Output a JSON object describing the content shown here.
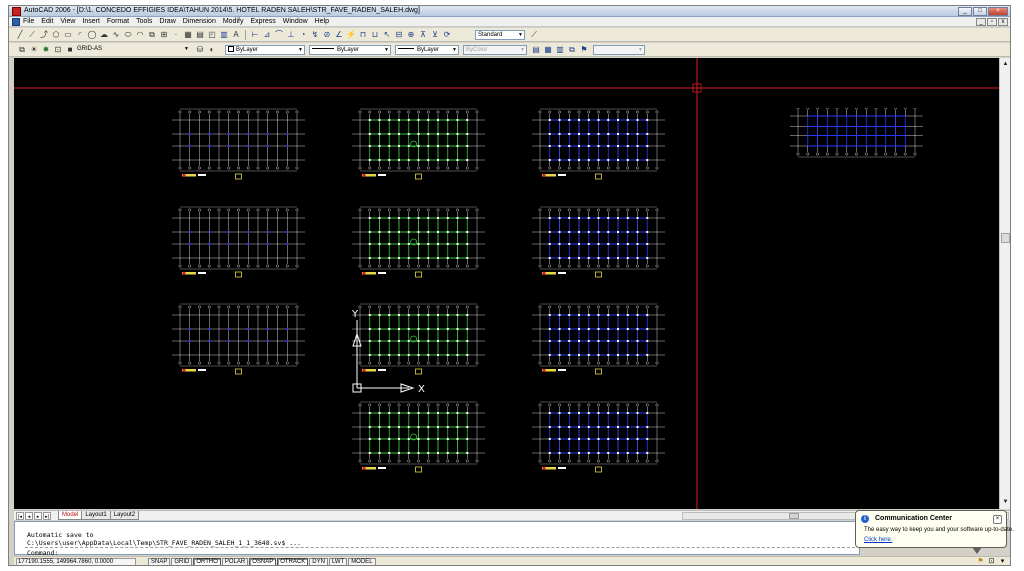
{
  "window": {
    "title": "AutoCAD 2006 - [D:\\1. CONCEDO EFFIGIES IDEA\\TAHUN 2014\\5. HOTEL RADEN SALEH\\STR_FAVE_RADEN_SALEH.dwg]",
    "controls": [
      "_",
      "□",
      "×"
    ]
  },
  "menu": {
    "items": [
      "File",
      "Edit",
      "View",
      "Insert",
      "Format",
      "Tools",
      "Draw",
      "Dimension",
      "Modify",
      "Express",
      "Window",
      "Help"
    ],
    "doc_controls": [
      "_",
      "▫",
      "x"
    ]
  },
  "toolbar": {
    "text_style": "Standard",
    "layer": "GRID-AS",
    "color": "ByLayer",
    "linetype": "ByLayer",
    "lineweight": "ByLayer",
    "plot_style": "ByColor"
  },
  "drawing": {
    "background": "#000000",
    "crosshair_color": "#d42020",
    "plan_colors": {
      "grid": "#ffffff",
      "green": "#34c534",
      "blue": "#2a38ff",
      "label": "#e8d64a"
    },
    "ucs": {
      "y_label": "Y",
      "x_label": "X"
    }
  },
  "layout_tabs": {
    "nav": [
      "|◂",
      "◂",
      "▸",
      "▸|"
    ],
    "tabs": [
      "Model",
      "Layout1",
      "Layout2"
    ],
    "active": "Model"
  },
  "command": {
    "line1": "Automatic save to",
    "line2": "C:\\Users\\user\\AppData\\Local\\Temp\\STR_FAVE_RADEN_SALEH_1_1_3648.sv$ ...",
    "prompt": "Command:"
  },
  "status": {
    "coordinates": "177190.1555, 149964.7860, 0.0000",
    "toggles": [
      "SNAP",
      "GRID",
      "ORTHO",
      "POLAR",
      "OSNAP",
      "OTRACK",
      "DYN",
      "LWT",
      "MODEL"
    ]
  },
  "balloon": {
    "title": "Communication Center",
    "text": "The easy way to keep you and your software up-to-date.",
    "link": "Click here."
  }
}
